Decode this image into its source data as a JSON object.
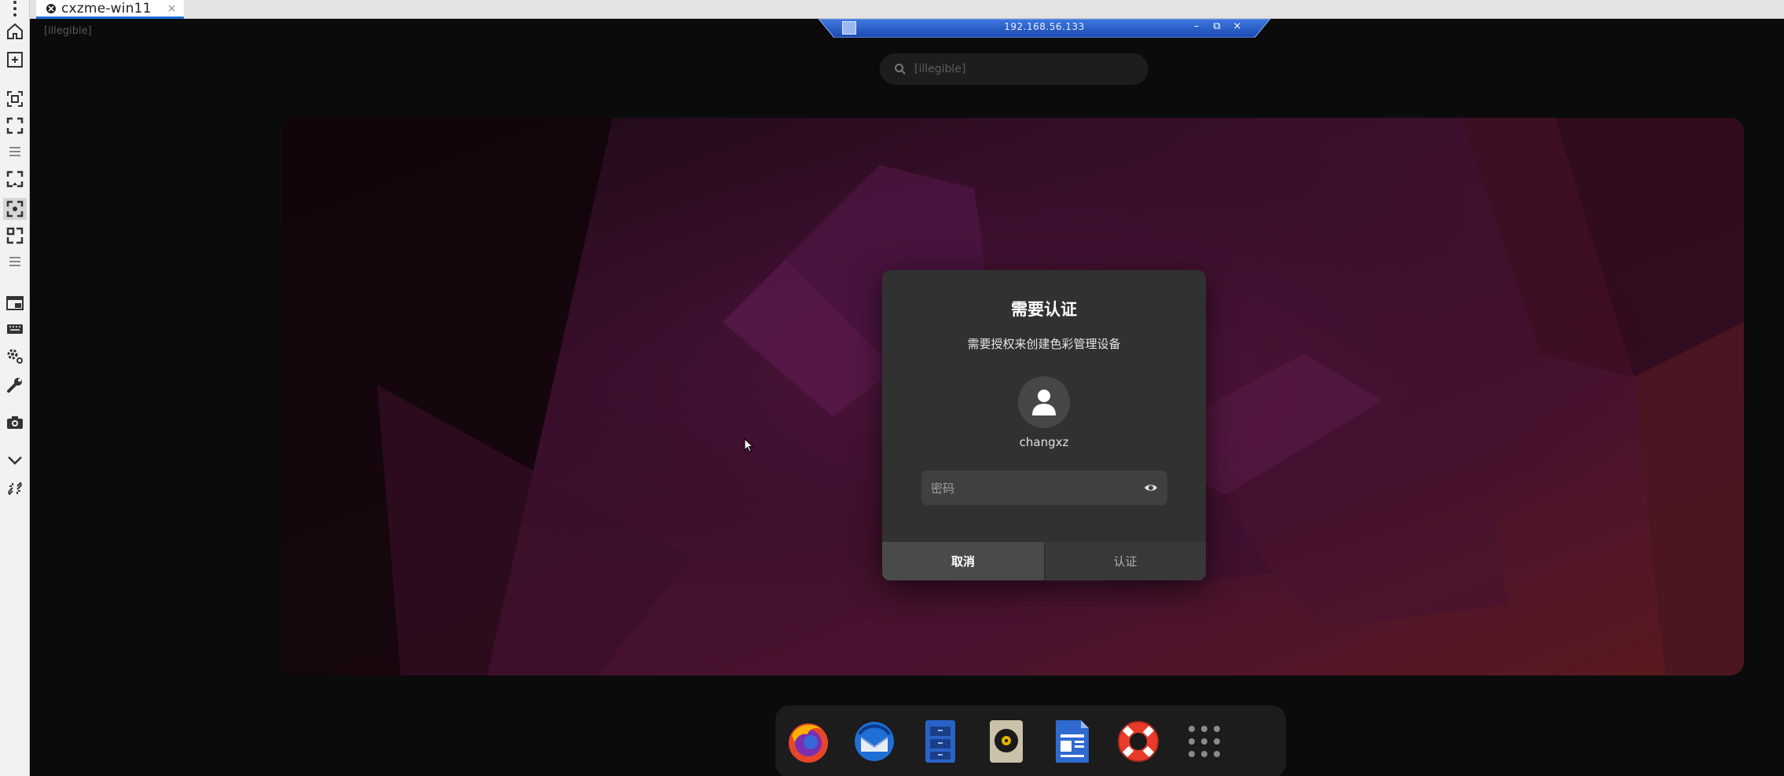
{
  "host": {
    "tab_title": "cxzme-win11",
    "tab_close": "×",
    "toolbar_icons": [
      "more-vert-icon",
      "home-icon",
      "new-window-icon",
      "fit-screen-icon",
      "fullscreen-icon",
      "menu-icon",
      "scale-screen-icon",
      "autofit-icon",
      "resize-icon",
      "menu-icon",
      "window-icon",
      "keyboard-icon",
      "settings-icon",
      "tools-icon",
      "camera-icon",
      "chevron-down-icon",
      "disconnect-icon"
    ]
  },
  "remote_bar": {
    "host": "192.168.56.133",
    "minimize": "–",
    "restore": "⧉",
    "close": "×"
  },
  "desktop": {
    "activities": "[illegible]",
    "search_placeholder": "[illegible]"
  },
  "dialog": {
    "title": "需要认证",
    "message": "需要授权来创建色彩管理设备",
    "username": "changxz",
    "password_placeholder": "密码",
    "cancel_label": "取消",
    "authenticate_label": "认证"
  },
  "dock": {
    "apps": [
      "firefox-icon",
      "thunderbird-icon",
      "files-icon",
      "rhythmbox-icon",
      "libreoffice-writer-icon",
      "help-icon",
      "app-grid-icon"
    ]
  },
  "colors": {
    "dialog_bg": "#313131",
    "accent_tab": "#1e6fd9",
    "remote_bar": "#1e56c8"
  }
}
